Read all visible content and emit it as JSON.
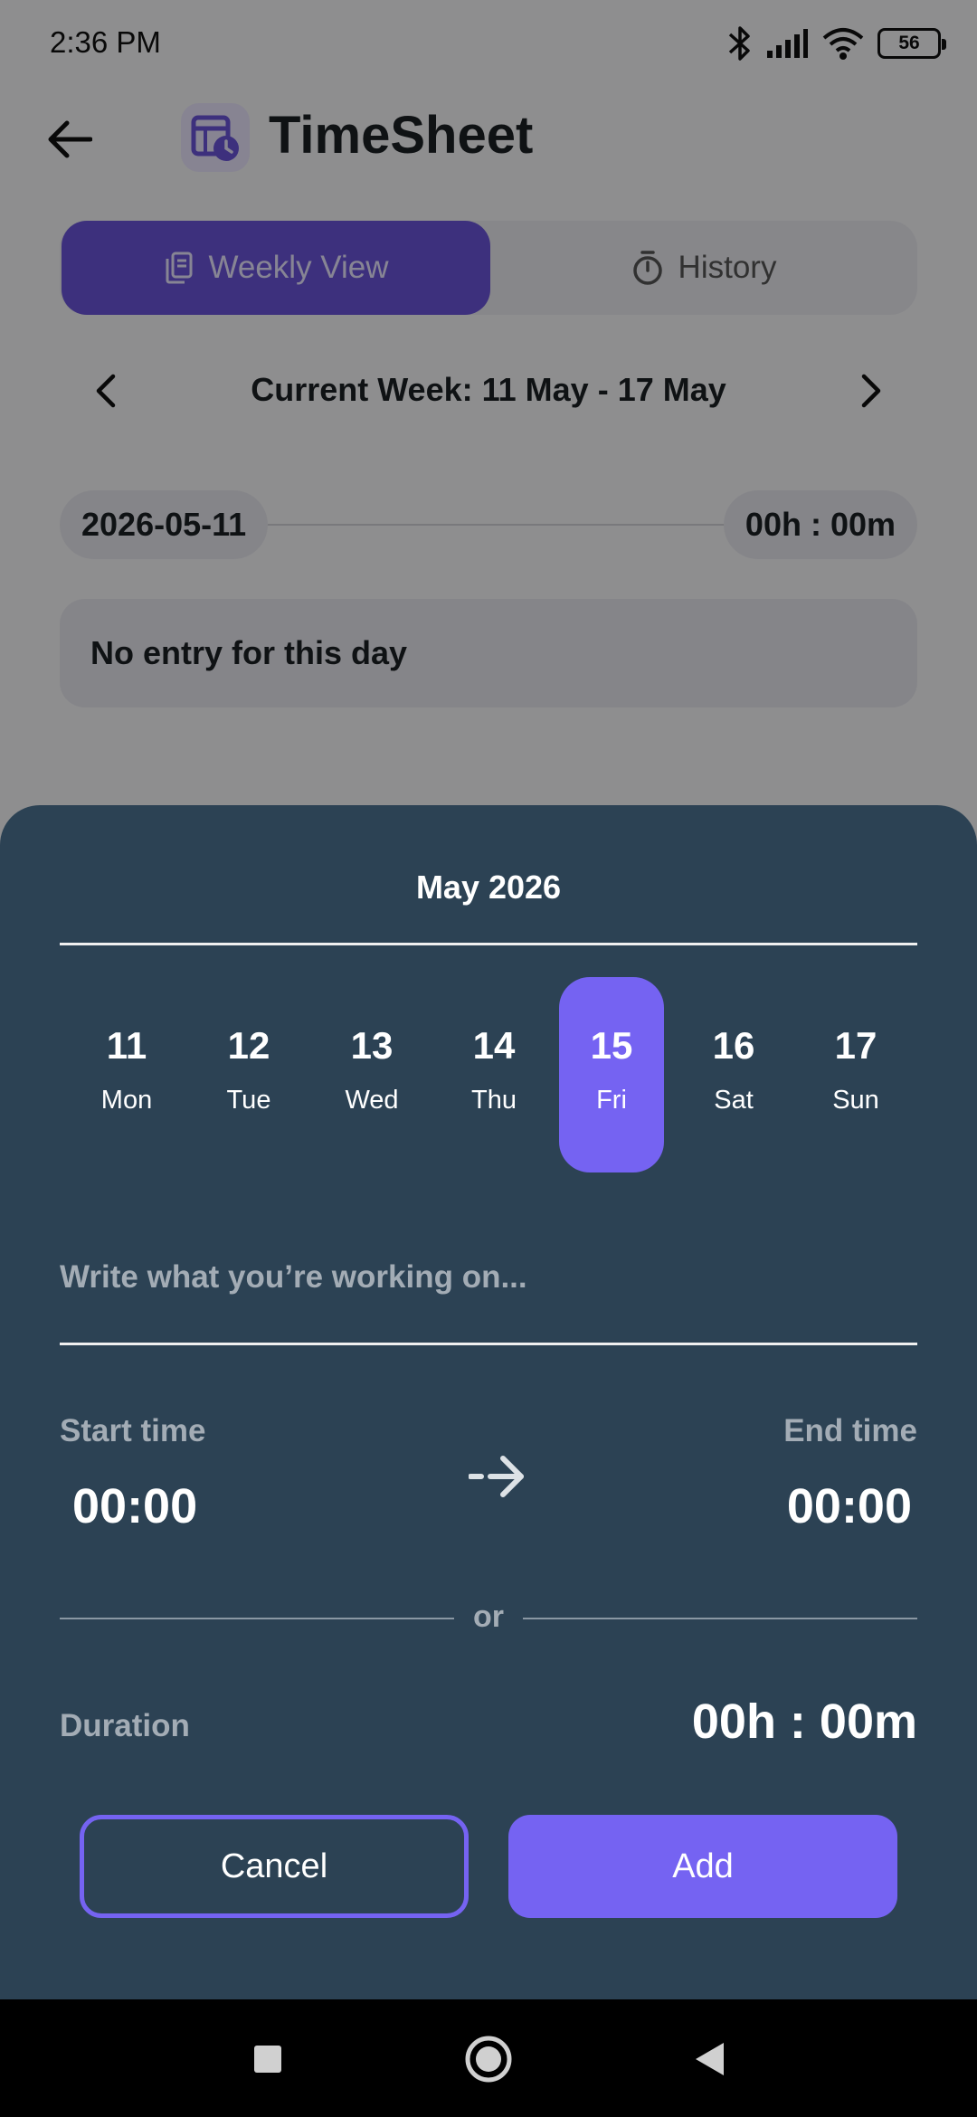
{
  "status_bar": {
    "time": "2:36 PM",
    "battery": "56"
  },
  "header": {
    "title": "TimeSheet"
  },
  "tabs": [
    {
      "label": "Weekly View",
      "icon": "copy-doc-icon",
      "active": true
    },
    {
      "label": "History",
      "icon": "stopwatch-icon",
      "active": false
    }
  ],
  "week_nav": {
    "label": "Current Week: 11 May - 17 May"
  },
  "day_row": {
    "date": "2026-05-11",
    "hours": "00h : 00m"
  },
  "empty_state": {
    "text": "No entry for this day"
  },
  "sheet": {
    "month": "May 2026",
    "days": [
      {
        "num": "11",
        "weekday": "Mon"
      },
      {
        "num": "12",
        "weekday": "Tue"
      },
      {
        "num": "13",
        "weekday": "Wed"
      },
      {
        "num": "14",
        "weekday": "Thu"
      },
      {
        "num": "15",
        "weekday": "Fri",
        "selected": true
      },
      {
        "num": "16",
        "weekday": "Sat"
      },
      {
        "num": "17",
        "weekday": "Sun"
      }
    ],
    "task_placeholder": "Write what you’re working on...",
    "start_label": "Start time",
    "start_value": "00:00",
    "end_label": "End time",
    "end_value": "00:00",
    "or_text": "or",
    "duration_label": "Duration",
    "duration_value": "00h : 00m",
    "cancel_label": "Cancel",
    "add_label": "Add"
  },
  "colors": {
    "accent": "#7563f2",
    "tab_active": "#6a54d8",
    "sheet_bg": "#2c4254",
    "muted_text": "#a3acb5"
  }
}
